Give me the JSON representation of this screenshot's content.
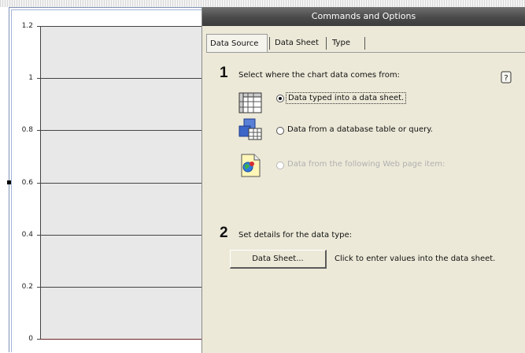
{
  "panel": {
    "title": "Commands and Options",
    "tabs": [
      {
        "label": "Data Source",
        "active": true
      },
      {
        "label": "Data Sheet",
        "active": false
      },
      {
        "label": "Type",
        "active": false
      }
    ],
    "step1": {
      "number": "1",
      "text": "Select where the chart data comes from:",
      "options": [
        {
          "label": "Data typed into a data sheet.",
          "icon": "datasheet-grid-icon",
          "selected": true,
          "enabled": true
        },
        {
          "label": "Data from a database table or query.",
          "icon": "database-icon",
          "selected": false,
          "enabled": true
        },
        {
          "label": "Data from the following Web page item:",
          "icon": "web-page-icon",
          "selected": false,
          "enabled": false
        }
      ]
    },
    "step2": {
      "number": "2",
      "text": "Set details for the data type:",
      "button_label": "Data Sheet...",
      "button_hint": "Click to enter values into the data sheet."
    },
    "help_icon": "help-icon"
  },
  "chart": {
    "y_ticks": [
      "1.2",
      "1",
      "0.8",
      "0.6",
      "0.4",
      "0.2",
      "0"
    ]
  },
  "colors": {
    "title_bar": "#4a4a4a",
    "panel_bg": "#ece9d8",
    "plot_bg": "#e8e8e8",
    "baseline": "#6b2222"
  }
}
